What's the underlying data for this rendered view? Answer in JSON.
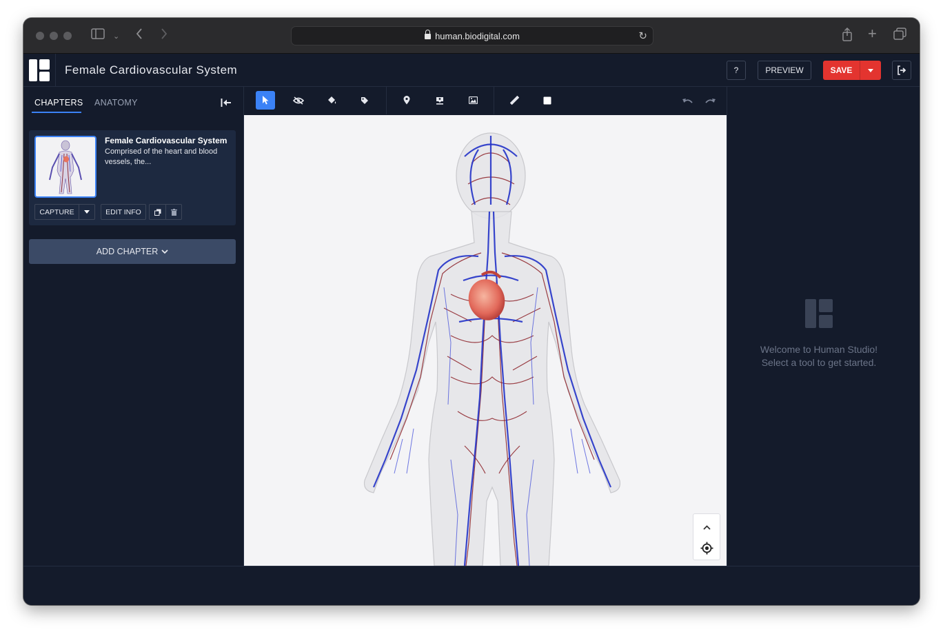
{
  "browser": {
    "url": "human.biodigital.com"
  },
  "app": {
    "title": "Female Cardiovascular System",
    "help_label": "?",
    "preview_label": "PREVIEW",
    "save_label": "SAVE"
  },
  "sidebar": {
    "tabs": [
      {
        "label": "CHAPTERS",
        "active": true
      },
      {
        "label": "ANATOMY",
        "active": false
      }
    ],
    "chapter": {
      "title": "Female Cardiovascular System",
      "description": "Comprised of the heart and blood vessels, the...",
      "capture_label": "CAPTURE",
      "edit_info_label": "EDIT INFO"
    },
    "add_chapter_label": "ADD CHAPTER"
  },
  "toolbar": {
    "tools": [
      "select-icon",
      "hide-icon",
      "paint-icon",
      "tag-icon",
      "pin-icon",
      "person-pin-icon",
      "image-icon",
      "ruler-icon",
      "square-icon"
    ],
    "active_tool": "select-icon"
  },
  "welcome": {
    "line1": "Welcome to Human Studio!",
    "line2": "Select a tool to get started."
  },
  "colors": {
    "accent": "#3b82f6",
    "save": "#e3342f",
    "background": "#141b2b",
    "card": "#1d2940"
  }
}
